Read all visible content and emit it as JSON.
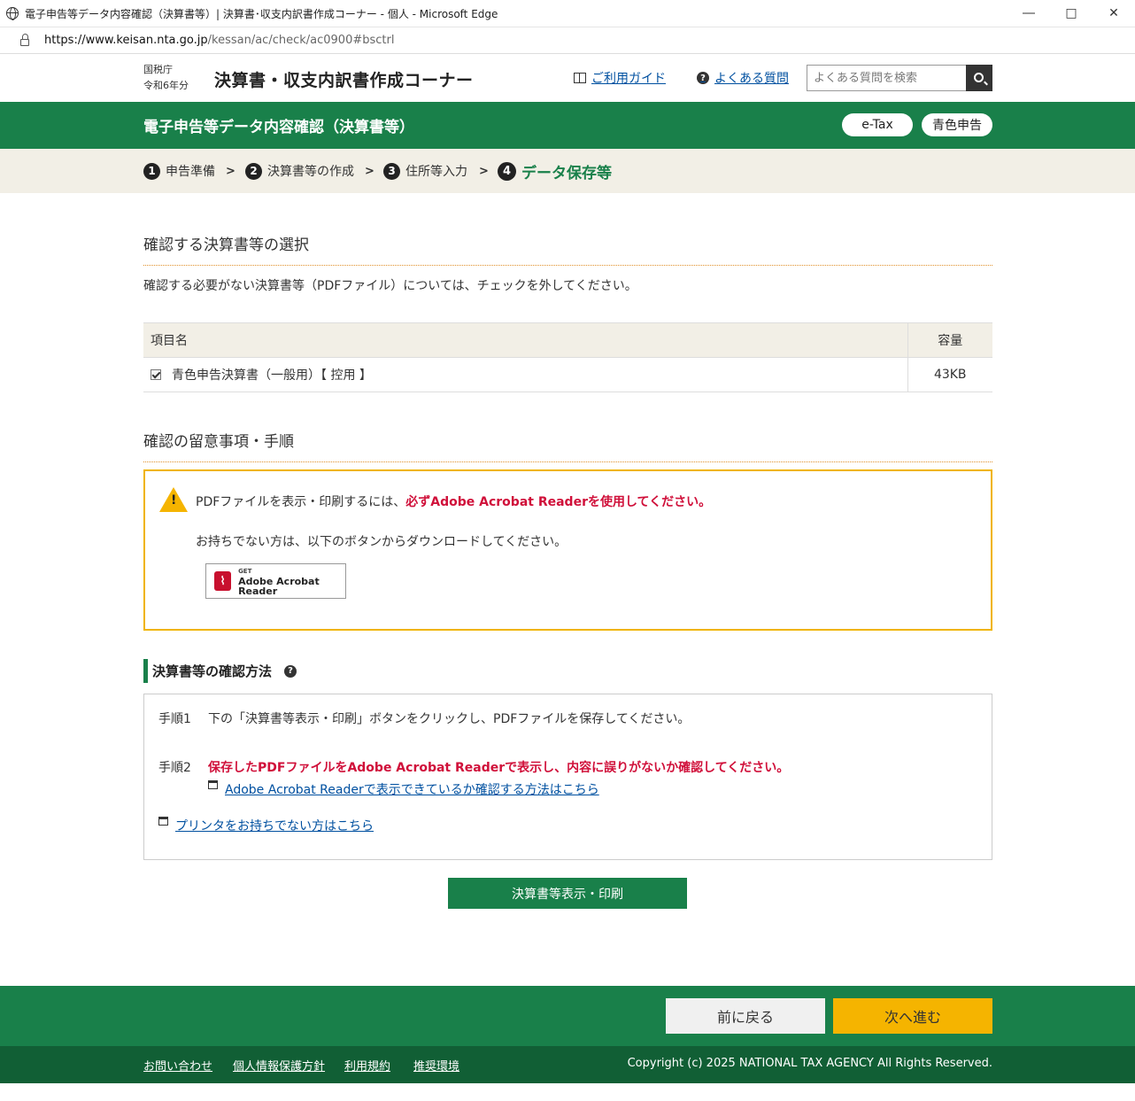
{
  "window": {
    "title": "電子申告等データ内容確認（決算書等）| 決算書･収支内訳書作成コーナー - 個人 - Microsoft Edge",
    "url_host": "https://www.keisan.nta.go.jp",
    "url_path": "/kessan/ac/check/ac0900#bsctrl"
  },
  "header": {
    "agency": "国税庁",
    "year": "令和6年分",
    "corner_title": "決算書・収支内訳書作成コーナー",
    "guide_link": "ご利用ガイド",
    "faq_link": "よくある質問",
    "search_placeholder": "よくある質問を検索"
  },
  "band": {
    "title": "電子申告等データ内容確認（決算書等）",
    "etax": "e-Tax",
    "blue": "青色申告"
  },
  "steps": [
    {
      "num": "1",
      "label": "申告準備"
    },
    {
      "num": "2",
      "label": "決算書等の作成"
    },
    {
      "num": "3",
      "label": "住所等入力"
    },
    {
      "num": "4",
      "label": "データ保存等"
    }
  ],
  "selection": {
    "title": "確認する決算書等の選択",
    "intro": "確認する必要がない決算書等（PDFファイル）については、チェックを外してください。",
    "col_name": "項目名",
    "col_size": "容量",
    "rows": [
      {
        "name": "青色申告決算書（一般用）【 控用 】",
        "size": "43KB",
        "checked": true
      }
    ]
  },
  "notes": {
    "title": "確認の留意事項・手順",
    "line1_prefix": "PDFファイルを表示・印刷するには、",
    "line1_emph": "必ずAdobe Acrobat Readerを使用してください。",
    "line2": "お持ちでない方は、以下のボタンからダウンロードしてください。",
    "acrobat_get": "GET",
    "acrobat_name": "Adobe Acrobat Reader"
  },
  "method": {
    "title": "決算書等の確認方法",
    "step1_label": "手順1",
    "step1_text": "下の「決算書等表示・印刷」ボタンをクリックし、PDFファイルを保存してください。",
    "step2_label": "手順2",
    "step2_text": "保存したPDFファイルをAdobe Acrobat Readerで表示し、内容に誤りがないか確認してください。",
    "step2_link": "Adobe Acrobat Readerで表示できているか確認する方法はこちら",
    "printer_link": "プリンタをお持ちでない方はこちら"
  },
  "print_button": "決算書等表示・印刷",
  "footer": {
    "back": "前に戻る",
    "next": "次へ進む",
    "links": [
      "お問い合わせ",
      "個人情報保護方針",
      "利用規約",
      "推奨環境"
    ],
    "copyright": "Copyright (c) 2025 NATIONAL TAX AGENCY All Rights Reserved."
  },
  "colors": {
    "brand_green": "#19804a",
    "footer_dark_green": "#115f35",
    "accent_yellow": "#f5b400",
    "alert_red": "#d0103a"
  }
}
